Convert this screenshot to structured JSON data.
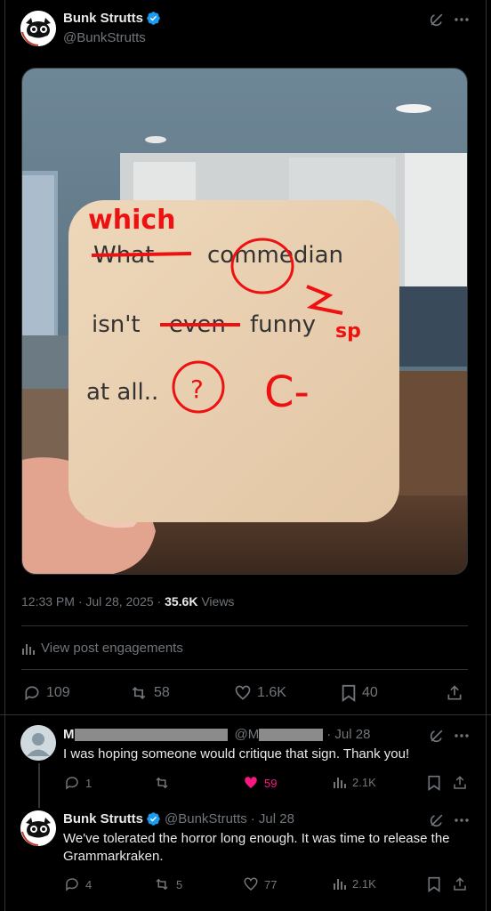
{
  "main_tweet": {
    "display_name": "Bunk Strutts",
    "handle": "@BunkStrutts",
    "photo_note": {
      "line1_struck": "What",
      "line1_correction": "which",
      "line1_word": "commedian",
      "line2_word1": "isn't",
      "line2_struck": "even",
      "line2_word3": "funny",
      "line2_mark": "sp",
      "line3": "at all..",
      "line3_mark": "?",
      "grade": "C-"
    },
    "timestamp": "12:33 PM · Jul 28, 2025 · ",
    "views_count": "35.6K",
    "views_label": " Views",
    "engagements_label": "View post engagements",
    "replies": "109",
    "reposts": "58",
    "likes": "1.6K",
    "bookmarks": "40"
  },
  "replies": [
    {
      "name_prefix": "M",
      "handle_prefix": "@M",
      "date": "· Jul 28",
      "text": "I was hoping someone would critique that sign. Thank you!",
      "replies": "1",
      "reposts": "",
      "likes": "59",
      "views": "2.1K"
    },
    {
      "display_name": "Bunk Strutts",
      "handle": "@BunkStrutts",
      "date": "· Jul 28",
      "text": "We've tolerated the horror long enough. It was time to release the Grammarkraken.",
      "replies": "4",
      "reposts": "5",
      "likes": "77",
      "views": "2.1K"
    }
  ],
  "colors": {
    "background": "#000000",
    "text": "#e7e9ea",
    "muted": "#71767b",
    "verified": "#1d9bf0",
    "like_active": "#f91880",
    "border": "#2f3336"
  }
}
